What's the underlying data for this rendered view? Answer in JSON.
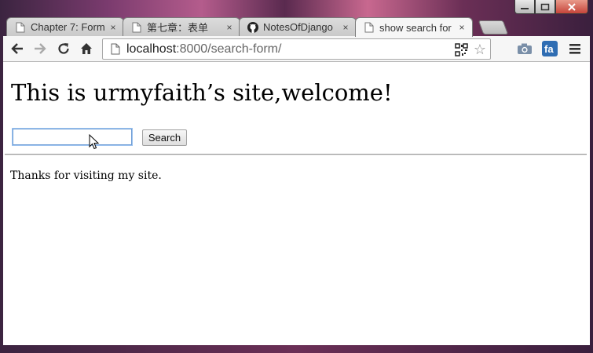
{
  "browser": {
    "tabs": [
      {
        "title": "Chapter 7: Form",
        "icon": "document-icon",
        "active": false
      },
      {
        "title": "第七章：表单",
        "icon": "document-icon",
        "active": false
      },
      {
        "title": "NotesOfDjango",
        "icon": "github-icon",
        "active": false
      },
      {
        "title": "show search for",
        "icon": "document-icon",
        "active": true
      }
    ],
    "close_glyph": "×",
    "url_host": "localhost",
    "url_rest": ":8000/search-form/"
  },
  "page": {
    "heading": "This is urmyfaith’s site,welcome!",
    "search_input_value": "",
    "search_button_label": "Search",
    "footer_text": "Thanks for visiting my site."
  }
}
